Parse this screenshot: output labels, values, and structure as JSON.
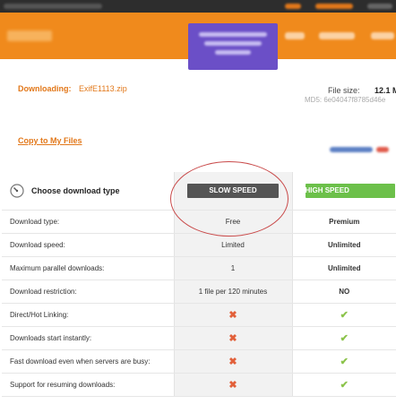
{
  "download": {
    "label": "Downloading:",
    "filename": "ExifE1113.zip",
    "file_size_label": "File size:",
    "file_size_value": "12.1 M",
    "md5": "MD5: 6e04047f8785d46e"
  },
  "copy_link": "Copy to My Files",
  "table": {
    "choose_label": "Choose download type",
    "slow_button": "SLOW SPEED",
    "high_button": "HIGH SPEED",
    "rows": [
      {
        "feature": "Download type:",
        "slow": "Free",
        "high": "Premium"
      },
      {
        "feature": "Download speed:",
        "slow": "Limited",
        "high": "Unlimited"
      },
      {
        "feature": "Maximum parallel downloads:",
        "slow": "1",
        "high": "Unlimited"
      },
      {
        "feature": "Download restriction:",
        "slow": "1 file per 120 minutes",
        "high": "NO"
      },
      {
        "feature": "Direct/Hot Linking:",
        "slow": "✖",
        "high": "✔"
      },
      {
        "feature": "Downloads start instantly:",
        "slow": "✖",
        "high": "✔"
      },
      {
        "feature": "Fast download even when servers are busy:",
        "slow": "✖",
        "high": "✔"
      },
      {
        "feature": "Support for resuming downloads:",
        "slow": "✖",
        "high": "✔"
      }
    ]
  },
  "colors": {
    "orange_header": "#f08a1c",
    "accent_orange": "#e2781a",
    "slow_button": "#555555",
    "high_button": "#6cc04a",
    "cross": "#e2603a",
    "check": "#8bc34a",
    "annotation_circle": "#c94a4a"
  }
}
